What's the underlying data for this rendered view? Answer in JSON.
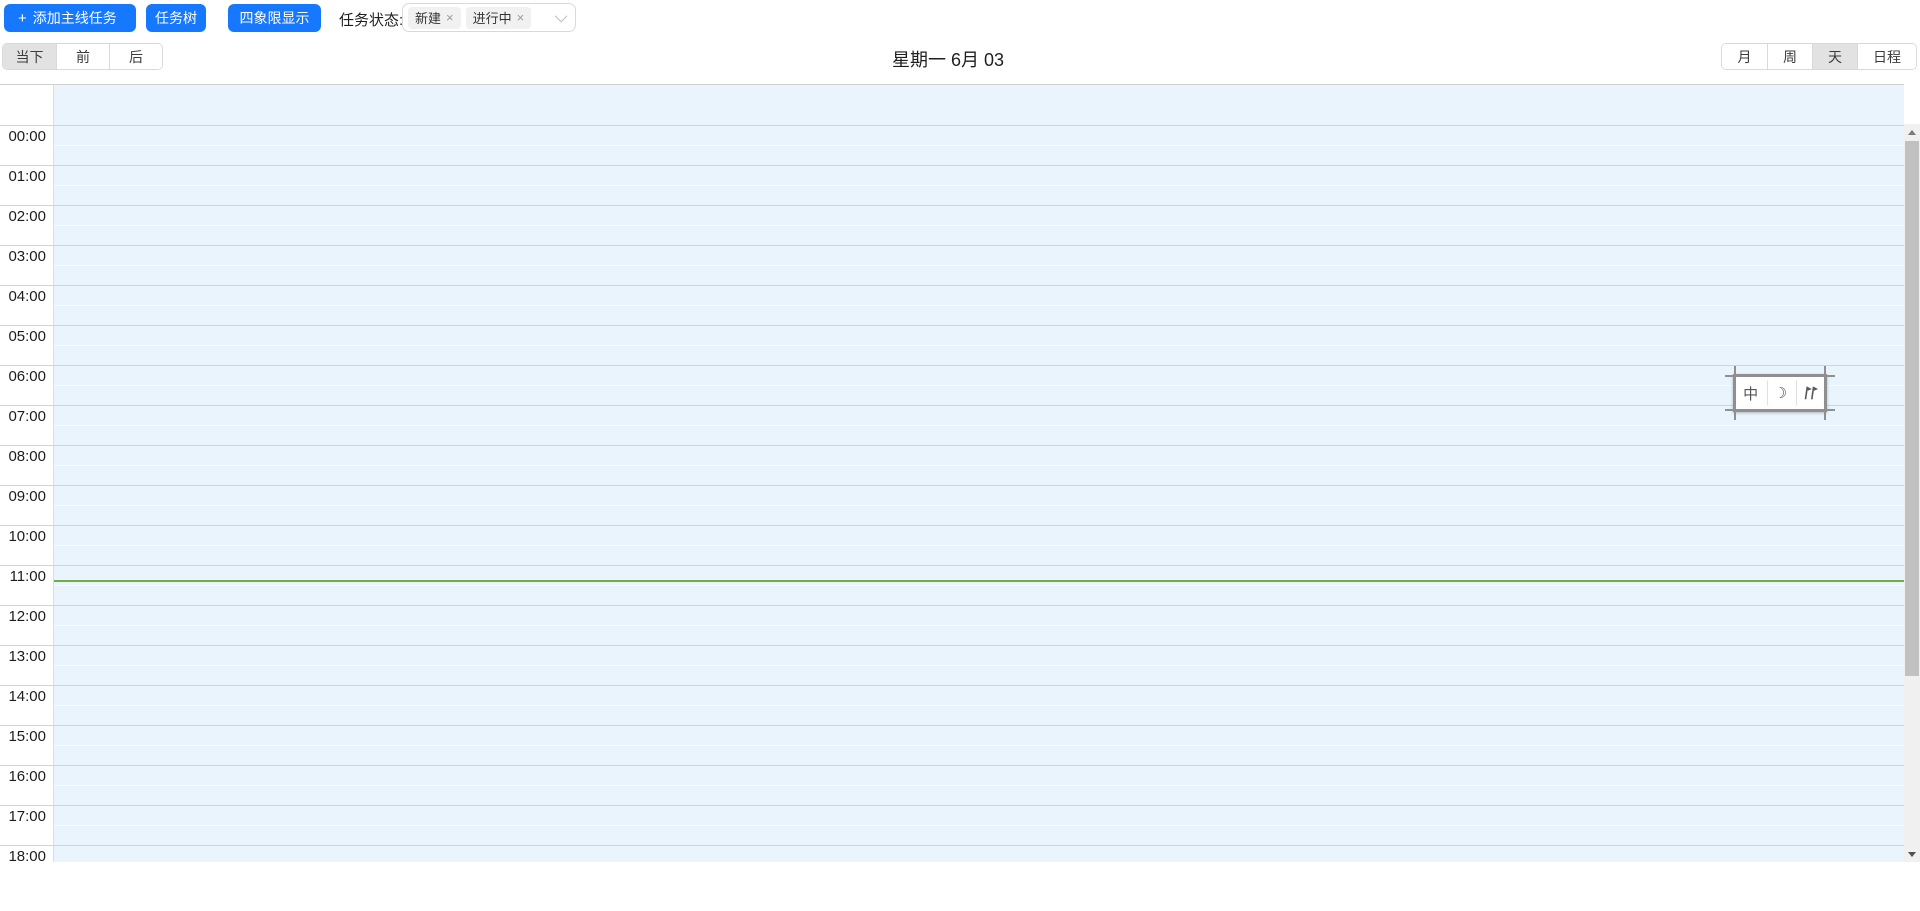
{
  "toolbar": {
    "add_main_task_label": "添加主线任务",
    "task_tree_label": "任务树",
    "quadrant_label": "四象限显示",
    "task_status_label": "任务状态:",
    "status_tags": [
      {
        "label": "新建"
      },
      {
        "label": "进行中"
      }
    ]
  },
  "header": {
    "now_label": "当下",
    "prev_label": "前",
    "next_label": "后",
    "title": "星期一 6月 03",
    "views": [
      {
        "label": "月",
        "active": false
      },
      {
        "label": "周",
        "active": false
      },
      {
        "label": "天",
        "active": true
      },
      {
        "label": "日程",
        "active": false
      }
    ]
  },
  "calendar": {
    "hours": [
      "00:00",
      "01:00",
      "02:00",
      "03:00",
      "04:00",
      "05:00",
      "06:00",
      "07:00",
      "08:00",
      "09:00",
      "10:00",
      "11:00",
      "12:00",
      "13:00",
      "14:00",
      "15:00",
      "16:00",
      "17:00",
      "18:00"
    ],
    "current_time_indicator": true
  },
  "ime": {
    "mode_label": "中",
    "moon_glyph": "☽"
  },
  "colors": {
    "accent": "#1677ff",
    "calendar_bg": "#e9f4fd",
    "grid_line": "#d4d4d4",
    "half_hour_line": "#f7fbff",
    "current_time_line": "#6fae49",
    "active_segment_bg": "#e2e2e2",
    "scrollbar_thumb": "#c1c1c1",
    "scrollbar_track": "#f0f0f0"
  }
}
